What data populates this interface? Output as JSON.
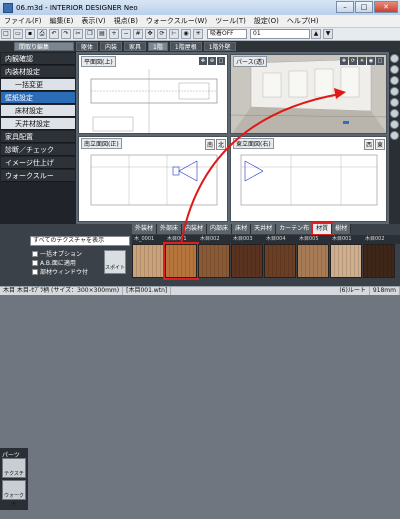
{
  "window": {
    "title": "06.m3d - INTERIOR DESIGNER Neo",
    "min": "–",
    "max": "□",
    "close": "✕"
  },
  "menu": [
    "ファイル(F)",
    "編集(E)",
    "表示(V)",
    "視点(B)",
    "ウォークスルー(W)",
    "ツール(T)",
    "設定(O)",
    "ヘルプ(H)"
  ],
  "toolbar": {
    "layer_field": "01",
    "snap_label": "吸着OFF"
  },
  "view_tabs": {
    "items": [
      "躯体",
      "内装",
      "家具",
      "1階",
      "1階屋根",
      "1階外壁"
    ],
    "selected": "1階",
    "mode_label": "間取り編集"
  },
  "sidebar": {
    "items": [
      {
        "label": "内観確認",
        "type": "head"
      },
      {
        "label": "内装材設定",
        "type": "head"
      },
      {
        "label": "一括変更",
        "type": "sub"
      },
      {
        "label": "壁紙設定",
        "type": "sel"
      },
      {
        "label": "床材設定",
        "type": "sub"
      },
      {
        "label": "天井材設定",
        "type": "sub"
      },
      {
        "label": "家具配置",
        "type": "head"
      },
      {
        "label": "診断／チェック",
        "type": "head"
      },
      {
        "label": "イメージ仕上げ",
        "type": "head"
      },
      {
        "label": "ウォークスルー",
        "type": "head"
      }
    ]
  },
  "viewports": {
    "plan": {
      "label": "平面図(上)"
    },
    "perspective": {
      "label": "パース(透)"
    },
    "south_elev": {
      "label": "南立面図(正)",
      "dir": "南",
      "dir2": "北"
    },
    "east_elev": {
      "label": "東立面図(右)",
      "dir": "西",
      "dir2": "東"
    }
  },
  "parts": {
    "label": "パーツ",
    "texture_label": "テクスチャ",
    "walk_label": "ウォーク",
    "select_value": "すべてのテクスチャを表示"
  },
  "checks": {
    "c1": "一括オプション",
    "c2": "A.B.面に適用",
    "c3": "部材ウィンドウ付",
    "c4": "スポイト"
  },
  "material_tabs": {
    "items": [
      "外装材",
      "外部床",
      "内装材",
      "内部床",
      "床材",
      "天井材",
      "カーテン布",
      "材質",
      "樹材"
    ],
    "selected": "材質"
  },
  "thumbs": {
    "labels": [
      "木_0001",
      "木目001",
      "木目002",
      "木目003",
      "木目004",
      "木目005",
      "木目001",
      "木目002"
    ],
    "colors": [
      "#c9a27a",
      "#b7753e",
      "#8a5a35",
      "#5a3320",
      "#6b3f24",
      "#a87b57",
      "#cfae8e",
      "#3e2618"
    ],
    "selected_index": 1
  },
  "status": {
    "left": "木目 木目-ｾﾌﾟﾗ柄 (サイズ：300×300mm)",
    "mid": "[木目001.wtn]",
    "right": "(6)ルート",
    "coords": "918mm"
  }
}
